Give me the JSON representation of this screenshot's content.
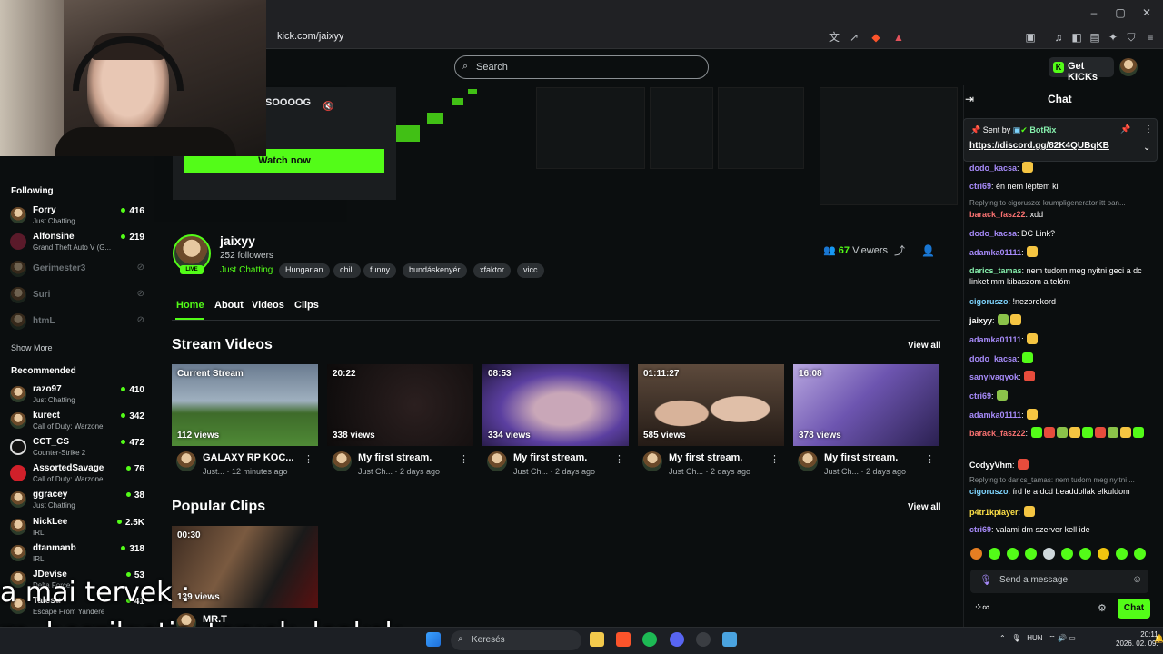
{
  "browser": {
    "url": "kick.com/jaixyy"
  },
  "header": {
    "search_placeholder": "Search",
    "get_kicks": "Get KICKs"
  },
  "promo": {
    "text": "SOOOOG",
    "watch_now": "Watch now"
  },
  "sidebar": {
    "following_title": "Following",
    "following": [
      {
        "name": "Forry",
        "sub": "Just Chatting",
        "viewers": "416"
      },
      {
        "name": "Alfonsine",
        "sub": "Grand Theft Auto V (G...",
        "viewers": "219"
      },
      {
        "name": "Gerimester3",
        "offline": true
      },
      {
        "name": "Suri",
        "offline": true
      },
      {
        "name": "htmL",
        "offline": true
      }
    ],
    "show_more": "Show More",
    "recommended_title": "Recommended",
    "recommended": [
      {
        "name": "razo97",
        "sub": "Just Chatting",
        "viewers": "410"
      },
      {
        "name": "kurect",
        "sub": "Call of Duty: Warzone",
        "viewers": "342"
      },
      {
        "name": "CCT_CS",
        "sub": "Counter-Strike 2",
        "viewers": "472"
      },
      {
        "name": "AssortedSavage",
        "sub": "Call of Duty: Warzone",
        "viewers": "76"
      },
      {
        "name": "ggracey",
        "sub": "Just Chatting",
        "viewers": "38"
      },
      {
        "name": "NickLee",
        "sub": "IRL",
        "viewers": "2.5K"
      },
      {
        "name": "dtanmanb",
        "sub": "IRL",
        "viewers": "318"
      },
      {
        "name": "JDevise",
        "sub": "Delta Force",
        "viewers": "53"
      },
      {
        "name": "Talesu",
        "sub": "Escape From Yandere",
        "viewers": "41"
      }
    ]
  },
  "profile": {
    "name": "jaixyy",
    "followers": "252 followers",
    "category": "Just Chatting",
    "tags": [
      "Hungarian",
      "chill",
      "funny",
      "bundáskenyér",
      "xfaktor",
      "vicc"
    ],
    "viewers_count": "67",
    "viewers_label": "Viewers",
    "live": "LIVE"
  },
  "tabs": [
    "Home",
    "About",
    "Videos",
    "Clips"
  ],
  "stream_videos": {
    "title": "Stream Videos",
    "view_all": "View all",
    "items": [
      {
        "badge": "Current Stream",
        "views": "112 views",
        "title": "GALAXY RP KOC...",
        "meta": "Just... · 12 minutes ago"
      },
      {
        "badge": "20:22",
        "views": "338 views",
        "title": "My first stream.",
        "meta": "Just Ch... · 2 days ago"
      },
      {
        "badge": "08:53",
        "views": "334 views",
        "title": "My first stream.",
        "meta": "Just Ch... · 2 days ago"
      },
      {
        "badge": "01:11:27",
        "views": "585 views",
        "title": "My first stream.",
        "meta": "Just Ch... · 2 days ago"
      },
      {
        "badge": "16:08",
        "views": "378 views",
        "title": "My first stream.",
        "meta": "Just Ch... · 2 days ago"
      }
    ]
  },
  "popular_clips": {
    "title": "Popular Clips",
    "view_all": "View all",
    "items": [
      {
        "badge": "00:30",
        "views": "139 views",
        "title": "MR.T"
      }
    ]
  },
  "chat": {
    "title": "Chat",
    "pinned_sent_by": "Sent by",
    "pinned_user": "BotRix",
    "pinned_link": "https://discord.gg/82K4QUBqKB",
    "messages": [
      {
        "user": "dodo_kacsa",
        "text": "",
        "color": "#a78bfa"
      },
      {
        "user": "ctri69",
        "text": "én nem léptem ki",
        "color": "#a78bfa"
      },
      {
        "reply": "Replying to cigoruszo: krumpligenerator itt pan...",
        "user": "barack_fasz22",
        "text": "xdd",
        "color": "#f87171"
      },
      {
        "user": "dodo_kacsa",
        "text": "DC Link?",
        "color": "#a78bfa"
      },
      {
        "user": "adamka01111",
        "text": "",
        "color": "#a78bfa"
      },
      {
        "user": "darics_tamas",
        "text": "nem tudom meg nyitni geci a dc linket mm kibaszom a telóm",
        "color": "#86efac"
      },
      {
        "user": "cigoruszo",
        "text": "!nezorekord",
        "color": "#7dd3fc"
      },
      {
        "user": "jaixyy",
        "text": "",
        "color": "#fff"
      },
      {
        "user": "adamka01111",
        "text": "",
        "color": "#a78bfa"
      },
      {
        "user": "dodo_kacsa",
        "text": "",
        "color": "#a78bfa"
      },
      {
        "user": "sanyivagyok",
        "text": "",
        "color": "#a78bfa"
      },
      {
        "user": "ctri69",
        "text": "",
        "color": "#a78bfa"
      },
      {
        "user": "adamka01111",
        "text": "",
        "color": "#a78bfa"
      },
      {
        "user": "barack_fasz22",
        "text": "",
        "color": "#f87171"
      },
      {
        "user": "CodyyVhm",
        "text": "",
        "color": "#fff"
      },
      {
        "reply": "Replying to darics_tamas: nem tudom meg nyitni ...",
        "user": "cigoruszo",
        "text": "írd le a dcd beaddollak elkuldom",
        "color": "#7dd3fc"
      },
      {
        "user": "p4tr1kplayer",
        "text": "",
        "color": "#fde047"
      },
      {
        "user": "ctri69",
        "text": "valami dm szerver kell ide",
        "color": "#a78bfa"
      }
    ],
    "input_placeholder": "Send a message",
    "send": "Chat"
  },
  "subtitles": {
    "line1": "a mai tervek :",
    "line2": "rp, beszilgetis, tervek, leakek,"
  },
  "taskbar": {
    "search": "Keresés",
    "lang": "HUN",
    "time": "20:11",
    "date": "2026. 02. 09."
  },
  "colors": {
    "accent": "#53fc18",
    "bg": "#0b0e0f"
  }
}
